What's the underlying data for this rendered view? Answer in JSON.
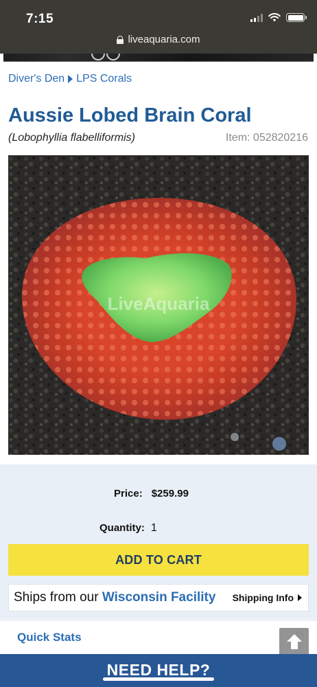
{
  "status_bar": {
    "time": "7:15",
    "url": "liveaquaria.com"
  },
  "breadcrumb": {
    "items": [
      "Diver's Den",
      "LPS Corals"
    ]
  },
  "product": {
    "title": "Aussie Lobed Brain Coral",
    "latin_name": "(Lobophyllia flabelliformis)",
    "item_number": "Item: 052820216",
    "image_watermark": "LiveAquaria"
  },
  "purchase": {
    "price_label": "Price:",
    "price_value": "$259.99",
    "quantity_label": "Quantity:",
    "quantity_value": "1",
    "add_to_cart_label": "ADD TO CART"
  },
  "shipping": {
    "ships_prefix": "Ships from our ",
    "ships_highlight": "Wisconsin Facility",
    "shipping_info_label": "Shipping Info"
  },
  "quick_stats": {
    "label": "Quick Stats"
  },
  "help_bar": {
    "label": "NEED HELP?"
  },
  "colors": {
    "title_blue": "#205b96",
    "link_blue": "#2c6db5",
    "cart_yellow": "#f6e13f",
    "help_bar_blue": "#285796",
    "panel_bg": "#e8eff7"
  }
}
